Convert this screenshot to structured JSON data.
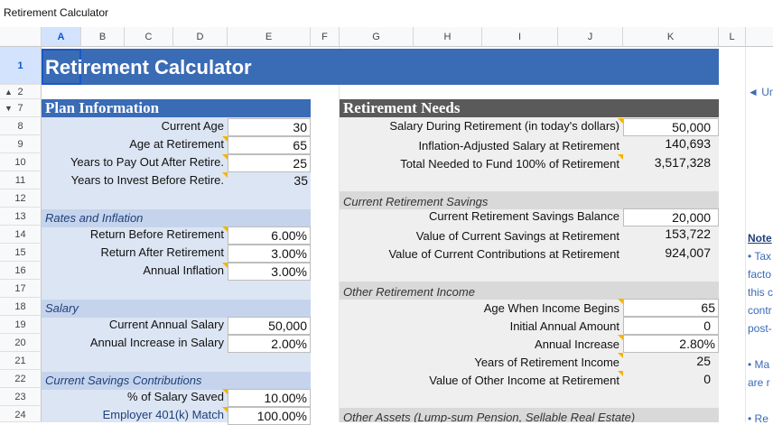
{
  "app": {
    "title": "Retirement Calculator"
  },
  "columns": [
    "A",
    "B",
    "C",
    "D",
    "E",
    "F",
    "G",
    "H",
    "I",
    "J",
    "K",
    "L"
  ],
  "rows": [
    "1",
    "2",
    "7",
    "8",
    "9",
    "10",
    "11",
    "12",
    "13",
    "14",
    "15",
    "16",
    "17",
    "18",
    "19",
    "20",
    "21",
    "22",
    "23",
    "24"
  ],
  "sheet_title": "Retirement Calculator",
  "left": {
    "header": "Plan Information",
    "fields": [
      {
        "label": "Current Age",
        "value": "30"
      },
      {
        "label": "Age at Retirement",
        "value": "65"
      },
      {
        "label": "Years to Pay Out After Retire.",
        "value": "25"
      },
      {
        "label": "Years to Invest Before Retire.",
        "value": "35"
      }
    ],
    "rates_header": "Rates and Inflation",
    "rates": [
      {
        "label": "Return Before Retirement",
        "value": "6.00%"
      },
      {
        "label": "Return After Retirement",
        "value": "3.00%"
      },
      {
        "label": "Annual Inflation",
        "value": "3.00%"
      }
    ],
    "salary_header": "Salary",
    "salary": [
      {
        "label": "Current Annual Salary",
        "value": "50,000"
      },
      {
        "label": "Annual Increase in Salary",
        "value": "2.00%"
      }
    ],
    "contrib_header": "Current Savings Contributions",
    "contrib": [
      {
        "label": "% of Salary Saved",
        "value": "10.00%"
      },
      {
        "label": "Employer 401(k) Match",
        "value": "100.00%"
      }
    ]
  },
  "right": {
    "header": "Retirement Needs",
    "needs": [
      {
        "label": "Salary During Retirement (in today's dollars)",
        "value": "50,000"
      },
      {
        "label": "Inflation-Adjusted Salary at Retirement",
        "value": "140,693"
      },
      {
        "label": "Total Needed to Fund 100% of Retirement",
        "value": "3,517,328"
      }
    ],
    "savings_header": "Current Retirement Savings",
    "savings": [
      {
        "label": "Current Retirement Savings Balance",
        "value": "20,000"
      },
      {
        "label": "Value of Current Savings at Retirement",
        "value": "153,722"
      },
      {
        "label": "Value of Current Contributions at Retirement",
        "value": "924,007"
      }
    ],
    "other_header": "Other Retirement Income",
    "other": [
      {
        "label": "Age When Income Begins",
        "value": "65"
      },
      {
        "label": "Initial Annual Amount",
        "value": "0"
      },
      {
        "label": "Annual Increase",
        "value": "2.80%"
      },
      {
        "label": "Years of Retirement Income",
        "value": "25"
      },
      {
        "label": "Value of Other Income at Retirement",
        "value": "0"
      }
    ],
    "assets_header": "Other Assets (Lump-sum Pension, Sellable Real Estate)"
  },
  "side": {
    "link": "◄ Un",
    "note_title": "Note",
    "note_lines": [
      "• Tax",
      "facto",
      "this c",
      "contr",
      "post-"
    ],
    "bullet2": [
      "• Ma",
      "are r"
    ],
    "bullet3": "• Re"
  }
}
